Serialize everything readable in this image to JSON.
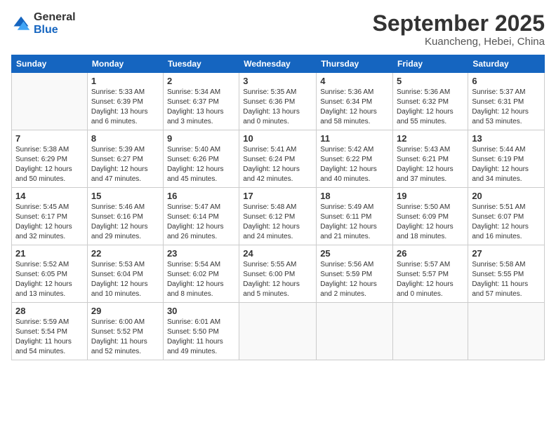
{
  "logo": {
    "general": "General",
    "blue": "Blue"
  },
  "header": {
    "month": "September 2025",
    "location": "Kuancheng, Hebei, China"
  },
  "weekdays": [
    "Sunday",
    "Monday",
    "Tuesday",
    "Wednesday",
    "Thursday",
    "Friday",
    "Saturday"
  ],
  "weeks": [
    [
      {
        "day": "",
        "info": ""
      },
      {
        "day": "1",
        "info": "Sunrise: 5:33 AM\nSunset: 6:39 PM\nDaylight: 13 hours\nand 6 minutes."
      },
      {
        "day": "2",
        "info": "Sunrise: 5:34 AM\nSunset: 6:37 PM\nDaylight: 13 hours\nand 3 minutes."
      },
      {
        "day": "3",
        "info": "Sunrise: 5:35 AM\nSunset: 6:36 PM\nDaylight: 13 hours\nand 0 minutes."
      },
      {
        "day": "4",
        "info": "Sunrise: 5:36 AM\nSunset: 6:34 PM\nDaylight: 12 hours\nand 58 minutes."
      },
      {
        "day": "5",
        "info": "Sunrise: 5:36 AM\nSunset: 6:32 PM\nDaylight: 12 hours\nand 55 minutes."
      },
      {
        "day": "6",
        "info": "Sunrise: 5:37 AM\nSunset: 6:31 PM\nDaylight: 12 hours\nand 53 minutes."
      }
    ],
    [
      {
        "day": "7",
        "info": "Sunrise: 5:38 AM\nSunset: 6:29 PM\nDaylight: 12 hours\nand 50 minutes."
      },
      {
        "day": "8",
        "info": "Sunrise: 5:39 AM\nSunset: 6:27 PM\nDaylight: 12 hours\nand 47 minutes."
      },
      {
        "day": "9",
        "info": "Sunrise: 5:40 AM\nSunset: 6:26 PM\nDaylight: 12 hours\nand 45 minutes."
      },
      {
        "day": "10",
        "info": "Sunrise: 5:41 AM\nSunset: 6:24 PM\nDaylight: 12 hours\nand 42 minutes."
      },
      {
        "day": "11",
        "info": "Sunrise: 5:42 AM\nSunset: 6:22 PM\nDaylight: 12 hours\nand 40 minutes."
      },
      {
        "day": "12",
        "info": "Sunrise: 5:43 AM\nSunset: 6:21 PM\nDaylight: 12 hours\nand 37 minutes."
      },
      {
        "day": "13",
        "info": "Sunrise: 5:44 AM\nSunset: 6:19 PM\nDaylight: 12 hours\nand 34 minutes."
      }
    ],
    [
      {
        "day": "14",
        "info": "Sunrise: 5:45 AM\nSunset: 6:17 PM\nDaylight: 12 hours\nand 32 minutes."
      },
      {
        "day": "15",
        "info": "Sunrise: 5:46 AM\nSunset: 6:16 PM\nDaylight: 12 hours\nand 29 minutes."
      },
      {
        "day": "16",
        "info": "Sunrise: 5:47 AM\nSunset: 6:14 PM\nDaylight: 12 hours\nand 26 minutes."
      },
      {
        "day": "17",
        "info": "Sunrise: 5:48 AM\nSunset: 6:12 PM\nDaylight: 12 hours\nand 24 minutes."
      },
      {
        "day": "18",
        "info": "Sunrise: 5:49 AM\nSunset: 6:11 PM\nDaylight: 12 hours\nand 21 minutes."
      },
      {
        "day": "19",
        "info": "Sunrise: 5:50 AM\nSunset: 6:09 PM\nDaylight: 12 hours\nand 18 minutes."
      },
      {
        "day": "20",
        "info": "Sunrise: 5:51 AM\nSunset: 6:07 PM\nDaylight: 12 hours\nand 16 minutes."
      }
    ],
    [
      {
        "day": "21",
        "info": "Sunrise: 5:52 AM\nSunset: 6:05 PM\nDaylight: 12 hours\nand 13 minutes."
      },
      {
        "day": "22",
        "info": "Sunrise: 5:53 AM\nSunset: 6:04 PM\nDaylight: 12 hours\nand 10 minutes."
      },
      {
        "day": "23",
        "info": "Sunrise: 5:54 AM\nSunset: 6:02 PM\nDaylight: 12 hours\nand 8 minutes."
      },
      {
        "day": "24",
        "info": "Sunrise: 5:55 AM\nSunset: 6:00 PM\nDaylight: 12 hours\nand 5 minutes."
      },
      {
        "day": "25",
        "info": "Sunrise: 5:56 AM\nSunset: 5:59 PM\nDaylight: 12 hours\nand 2 minutes."
      },
      {
        "day": "26",
        "info": "Sunrise: 5:57 AM\nSunset: 5:57 PM\nDaylight: 12 hours\nand 0 minutes."
      },
      {
        "day": "27",
        "info": "Sunrise: 5:58 AM\nSunset: 5:55 PM\nDaylight: 11 hours\nand 57 minutes."
      }
    ],
    [
      {
        "day": "28",
        "info": "Sunrise: 5:59 AM\nSunset: 5:54 PM\nDaylight: 11 hours\nand 54 minutes."
      },
      {
        "day": "29",
        "info": "Sunrise: 6:00 AM\nSunset: 5:52 PM\nDaylight: 11 hours\nand 52 minutes."
      },
      {
        "day": "30",
        "info": "Sunrise: 6:01 AM\nSunset: 5:50 PM\nDaylight: 11 hours\nand 49 minutes."
      },
      {
        "day": "",
        "info": ""
      },
      {
        "day": "",
        "info": ""
      },
      {
        "day": "",
        "info": ""
      },
      {
        "day": "",
        "info": ""
      }
    ]
  ]
}
